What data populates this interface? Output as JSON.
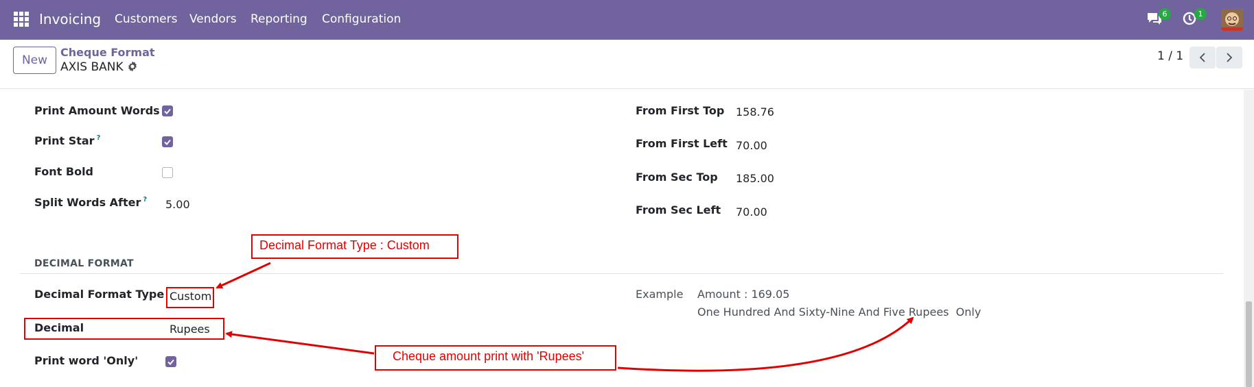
{
  "nav": {
    "app_name": "Invoicing",
    "menus": [
      "Customers",
      "Vendors",
      "Reporting",
      "Configuration"
    ],
    "messages_badge": "6",
    "activities_badge": "1",
    "icons": [
      "apps-grid-icon",
      "chat-icon",
      "clock-icon",
      "avatar"
    ]
  },
  "control": {
    "new_label": "New",
    "breadcrumb": "Cheque Format",
    "record_name": "AXIS BANK",
    "pager": "1 / 1"
  },
  "form": {
    "left": {
      "print_amount_words": {
        "label": "Print Amount Words",
        "checked": true
      },
      "print_star": {
        "label": "Print Star",
        "help": "?",
        "checked": true
      },
      "font_bold": {
        "label": "Font Bold",
        "checked": false
      },
      "split_words_after": {
        "label": "Split Words After",
        "help": "?",
        "value": "5.00"
      }
    },
    "right": {
      "from_first_top": {
        "label": "From First Top",
        "value": "158.76"
      },
      "from_first_left": {
        "label": "From First Left",
        "value": "70.00"
      },
      "from_sec_top": {
        "label": "From Sec Top",
        "value": "185.00"
      },
      "from_sec_left": {
        "label": "From Sec Left",
        "value": "70.00"
      }
    },
    "decimal_section": {
      "title": "DECIMAL FORMAT",
      "decimal_format_type": {
        "label": "Decimal Format Type",
        "value": "Custom"
      },
      "decimal": {
        "label": "Decimal",
        "value": "Rupees"
      },
      "print_word_only": {
        "label": "Print word 'Only'",
        "checked": true
      },
      "example": {
        "label": "Example",
        "amount_line": "Amount : 169.05",
        "words_line": "One Hundred And Sixty-Nine And Five Rupees  Only"
      }
    }
  },
  "annotations": {
    "decimal_type_note": "Decimal Format Type : Custom",
    "rupees_note": "Cheque amount print with 'Rupees'"
  },
  "colors": {
    "navbar": "#71639e",
    "accent": "#71639e",
    "annotation": "#e30000",
    "badge": "#28a745"
  }
}
